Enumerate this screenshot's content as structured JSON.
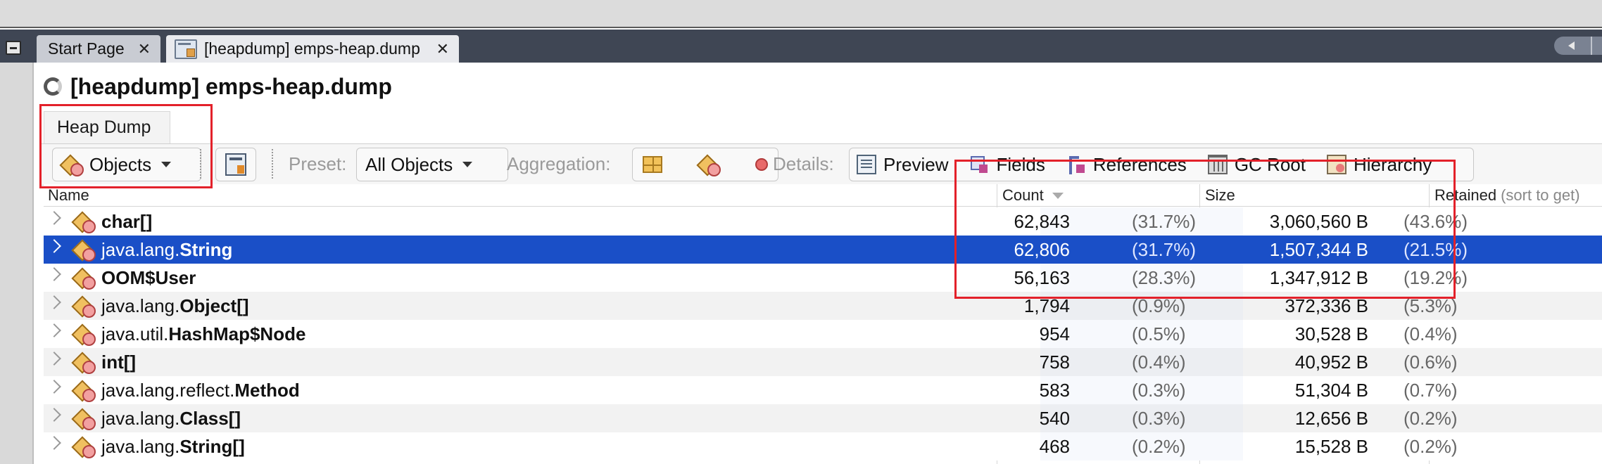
{
  "tabs": {
    "start_page": "Start Page",
    "heap": "[heapdump] emps-heap.dump"
  },
  "page_title": "[heapdump] emps-heap.dump",
  "section_tab": "Heap Dump",
  "toolbar": {
    "view_selector": "Objects",
    "preset_label": "Preset:",
    "preset_value": "All Objects",
    "aggregation_label": "Aggregation:",
    "details_label": "Details:",
    "details": {
      "preview": "Preview",
      "fields": "Fields",
      "references": "References",
      "gc_root": "GC Root",
      "hierarchy": "Hierarchy"
    }
  },
  "table": {
    "headers": {
      "name": "Name",
      "count": "Count",
      "size": "Size",
      "retained": "Retained",
      "retained_hint": "(sort to get)"
    },
    "rows": [
      {
        "pkg": "",
        "cls": "char[]",
        "count": "62,843",
        "count_pct": "(31.7%)",
        "size": "3,060,560 B",
        "size_pct": "(43.6%)"
      },
      {
        "pkg": "java.lang.",
        "cls": "String",
        "count": "62,806",
        "count_pct": "(31.7%)",
        "size": "1,507,344 B",
        "size_pct": "(21.5%)"
      },
      {
        "pkg": "",
        "cls": "OOM$User",
        "count": "56,163",
        "count_pct": "(28.3%)",
        "size": "1,347,912 B",
        "size_pct": "(19.2%)"
      },
      {
        "pkg": "java.lang.",
        "cls": "Object[]",
        "count": "1,794",
        "count_pct": "(0.9%)",
        "size": "372,336 B",
        "size_pct": "(5.3%)"
      },
      {
        "pkg": "java.util.",
        "cls": "HashMap$Node",
        "count": "954",
        "count_pct": "(0.5%)",
        "size": "30,528 B",
        "size_pct": "(0.4%)"
      },
      {
        "pkg": "",
        "cls": "int[]",
        "count": "758",
        "count_pct": "(0.4%)",
        "size": "40,952 B",
        "size_pct": "(0.6%)"
      },
      {
        "pkg": "java.lang.reflect.",
        "cls": "Method",
        "count": "583",
        "count_pct": "(0.3%)",
        "size": "51,304 B",
        "size_pct": "(0.7%)"
      },
      {
        "pkg": "java.lang.",
        "cls": "Class[]",
        "count": "540",
        "count_pct": "(0.3%)",
        "size": "12,656 B",
        "size_pct": "(0.2%)"
      },
      {
        "pkg": "java.lang.",
        "cls": "String[]",
        "count": "468",
        "count_pct": "(0.2%)",
        "size": "15,528 B",
        "size_pct": "(0.2%)"
      }
    ],
    "selected_row": 1
  },
  "colors": {
    "selection": "#1a4fc7",
    "highlight_box": "#e3212a",
    "tab_bar": "#3f4654"
  }
}
